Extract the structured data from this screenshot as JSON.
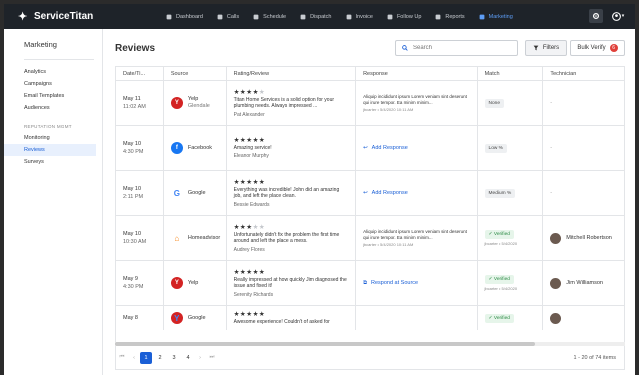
{
  "app": {
    "logo_text": "ServiceTitan",
    "nav": [
      {
        "label": "Dashboard",
        "icon": "dashboard-icon",
        "active": false
      },
      {
        "label": "Calls",
        "icon": "phone-icon",
        "active": false
      },
      {
        "label": "Schedule",
        "icon": "calendar-icon",
        "active": false
      },
      {
        "label": "Dispatch",
        "icon": "truck-icon",
        "active": false
      },
      {
        "label": "Invoice",
        "icon": "invoice-icon",
        "active": false
      },
      {
        "label": "Follow Up",
        "icon": "flag-icon",
        "active": false
      },
      {
        "label": "Reports",
        "icon": "reports-icon",
        "active": false
      },
      {
        "label": "Marketing",
        "icon": "megaphone-icon",
        "active": true
      }
    ]
  },
  "sidebar": {
    "title": "Marketing",
    "items": [
      "Analytics",
      "Campaigns",
      "Email Templates",
      "Audiences"
    ],
    "section_label": "REPUTATION MGMT",
    "section_items": [
      "Monitoring",
      "Reviews",
      "Surveys"
    ],
    "active_item": "Reviews"
  },
  "page": {
    "title": "Reviews",
    "search_placeholder": "Search",
    "filters_label": "Filters",
    "bulk_verify_label": "Bulk Verify",
    "bulk_verify_count": "6"
  },
  "table": {
    "columns": [
      "Date/Ti...",
      "Source",
      "Rating/Review",
      "Response",
      "Match",
      "Technician"
    ],
    "rows": [
      {
        "date": "May 11",
        "time": "11:02 AM",
        "source": "Yelp",
        "source_sub": "Glendale",
        "source_color": "#d32323",
        "source_letter": "Y",
        "stars": 4,
        "review": "Titan Home Services is a solid option for your plumbing needs. Always impressed ...",
        "author": "Pat Alexander",
        "response": "Aliquip incididunt ipsum Lorem veniam sint deserunt qui irure tempor. Ea minim minim...",
        "response_meta": "jbcarter • 5/4/2020 10:11 AM",
        "match": "None",
        "verified": false,
        "verified_meta": "",
        "technician": "-",
        "has_tech": false
      },
      {
        "date": "May 10",
        "time": "4:30 PM",
        "source": "Facebook",
        "source_sub": "",
        "source_color": "#1877f2",
        "source_letter": "f",
        "stars": 5,
        "review": "Amazing service!",
        "author": "Eleanor Murphy",
        "response": "",
        "response_meta": "",
        "add_response": "Add Response",
        "match": "Low %",
        "verified": false,
        "verified_meta": "",
        "technician": "-",
        "has_tech": false
      },
      {
        "date": "May 10",
        "time": "2:11 PM",
        "source": "Google",
        "source_sub": "",
        "source_color": "#ffffff",
        "source_letter": "G",
        "stars": 5,
        "review": "Everything was incredible! John did an amazing job, and left the place clean.",
        "author": "Bessie Edwards",
        "response": "",
        "response_meta": "",
        "add_response": "Add Response",
        "match": "Medium %",
        "verified": false,
        "verified_meta": "",
        "technician": "-",
        "has_tech": false
      },
      {
        "date": "May 10",
        "time": "10:30 AM",
        "source": "Homeadvisor",
        "source_sub": "",
        "source_color": "#f68315",
        "source_letter": "H",
        "stars": 3,
        "review": "Unfortunately didn't fix the problem the first time around and left the place a mess.",
        "author": "Audrey Flores",
        "response": "Aliquip incididunt ipsum Lorem veniam sint deserunt qui irure tempor. Ea minim minim...",
        "response_meta": "jbcarter • 5/4/2020 10:11 AM",
        "match": "Verified",
        "verified": true,
        "verified_meta": "jbcarter • 5/4/2020",
        "technician": "Mitchell Robertson",
        "has_tech": true
      },
      {
        "date": "May 9",
        "time": "4:30 PM",
        "source": "Yelp",
        "source_sub": "",
        "source_color": "#d32323",
        "source_letter": "Y",
        "stars": 5,
        "review": "Really impressed at how quickly Jim diagnosed the issue and fixed it!",
        "author": "Serenity Richards",
        "response": "",
        "response_meta": "",
        "add_response": "Respond at Source",
        "match": "Verified",
        "verified": true,
        "verified_meta": "jbcarter • 5/4/2020",
        "technician": "Jim Williamson",
        "has_tech": true
      },
      {
        "date": "May 8",
        "time": "",
        "source": "Google",
        "source_sub": "",
        "source_color": "#d32323",
        "source_letter": "Y",
        "stars": 5,
        "review": "Awesome experience! Couldn't of asked for",
        "author": "",
        "response": "",
        "response_meta": "",
        "match": "Verified",
        "verified": true,
        "verified_meta": "",
        "technician": "",
        "has_tech": true
      }
    ]
  },
  "pagination": {
    "pages": [
      "1",
      "2",
      "3",
      "4"
    ],
    "active_page": "1",
    "count_text": "1 - 20 of 74 items"
  }
}
